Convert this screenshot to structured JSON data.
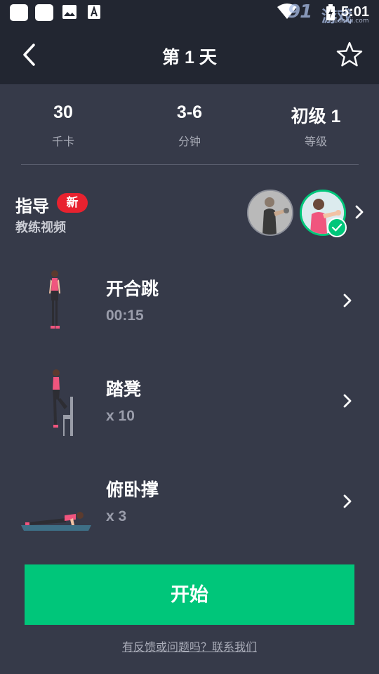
{
  "status_bar": {
    "time": "5:01",
    "watermark_logo": "91",
    "watermark_text": "游戏",
    "watermark_site": "91danji.com",
    "icons": [
      "app-icon",
      "app-icon",
      "image-icon",
      "font-icon",
      "wifi-icon",
      "battery-icon"
    ]
  },
  "header": {
    "title": "第 1 天",
    "back_icon": "back-arrow-icon",
    "favorite_icon": "star-outline-icon"
  },
  "stats": [
    {
      "value": "30",
      "label": "千卡"
    },
    {
      "value": "3-6",
      "label": "分钟"
    },
    {
      "value": "初级 1",
      "label": "等级"
    }
  ],
  "guide": {
    "title": "指导",
    "badge": "新",
    "subtitle": "教练视频",
    "coaches": [
      "coach-avatar",
      "coach-avatar-selected"
    ]
  },
  "exercises": [
    {
      "name": "开合跳",
      "detail": "00:15",
      "icon": "jumping-jack-figure"
    },
    {
      "name": "踏凳",
      "detail": "x 10",
      "icon": "step-up-figure"
    },
    {
      "name": "俯卧撑",
      "detail": "x 3",
      "icon": "push-up-figure"
    }
  ],
  "actions": {
    "start_label": "开始",
    "feedback_label": "有反馈或问题吗？联系我们"
  },
  "colors": {
    "background": "#363a49",
    "header_bg": "#222631",
    "accent": "#00c67a",
    "badge": "#e8222f"
  }
}
